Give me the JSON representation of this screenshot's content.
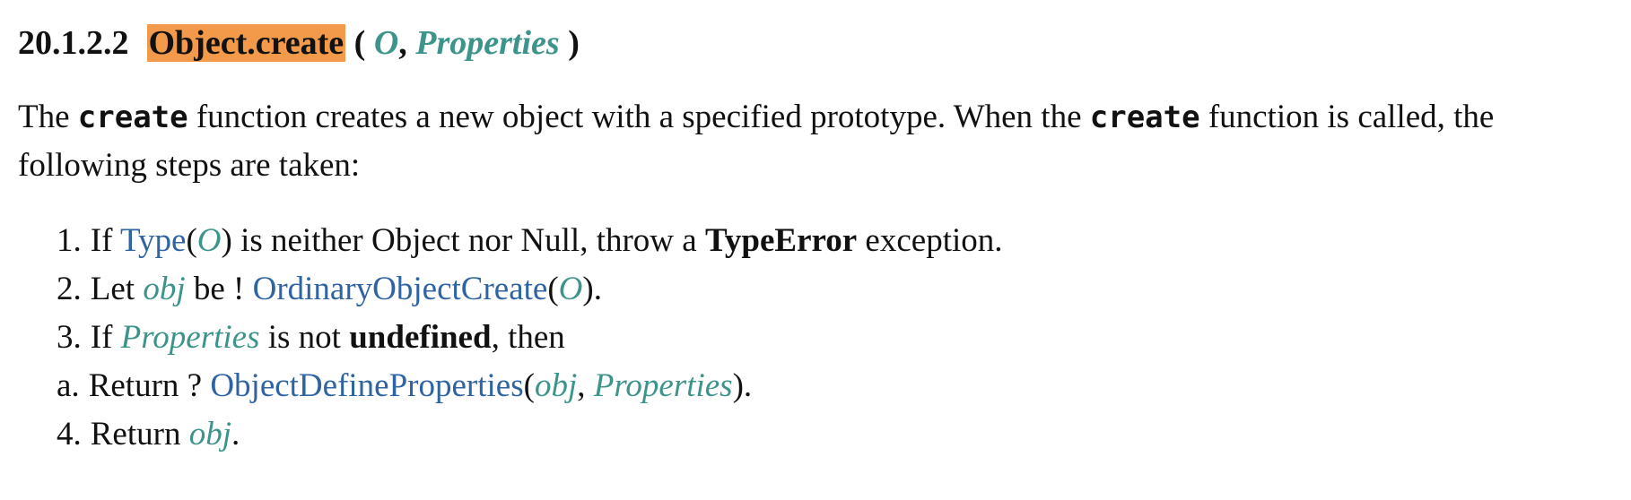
{
  "heading": {
    "section_number": "20.1.2.2",
    "function_name": "Object.create",
    "open_paren": "(",
    "param1": "O",
    "comma": ",",
    "param2": "Properties",
    "close_paren": ")",
    "highlight_color": "#f2994a"
  },
  "intro": {
    "part1": "The ",
    "code1": "create",
    "part2": " function creates a new object with a specified prototype. When the ",
    "code2": "create",
    "part3": " function is called, the following steps are taken:"
  },
  "steps": {
    "s1": {
      "num": "1.",
      "t1": "If ",
      "link": "Type",
      "p_open": "(",
      "var": "O",
      "p_close": ")",
      "t2": " is neither Object nor Null, throw a ",
      "bold": "TypeError",
      "t3": " exception."
    },
    "s2": {
      "num": "2.",
      "t1": "Let ",
      "var1": "obj",
      "t2": " be ! ",
      "link": "OrdinaryObjectCreate",
      "p_open": "(",
      "var2": "O",
      "p_close": ")."
    },
    "s3": {
      "num": "3.",
      "t1": "If ",
      "var": "Properties",
      "t2": " is not ",
      "bold": "undefined",
      "t3": ", then",
      "sub": {
        "num": "a.",
        "t1": "Return ? ",
        "link": "ObjectDefineProperties",
        "p_open": "(",
        "var1": "obj",
        "comma": ", ",
        "var2": "Properties",
        "p_close": ")."
      }
    },
    "s4": {
      "num": "4.",
      "t1": "Return ",
      "var": "obj",
      "t2": "."
    }
  },
  "colors": {
    "variable": "#3d948b",
    "abstract_op_link": "#2f64a3",
    "text": "#111111"
  }
}
